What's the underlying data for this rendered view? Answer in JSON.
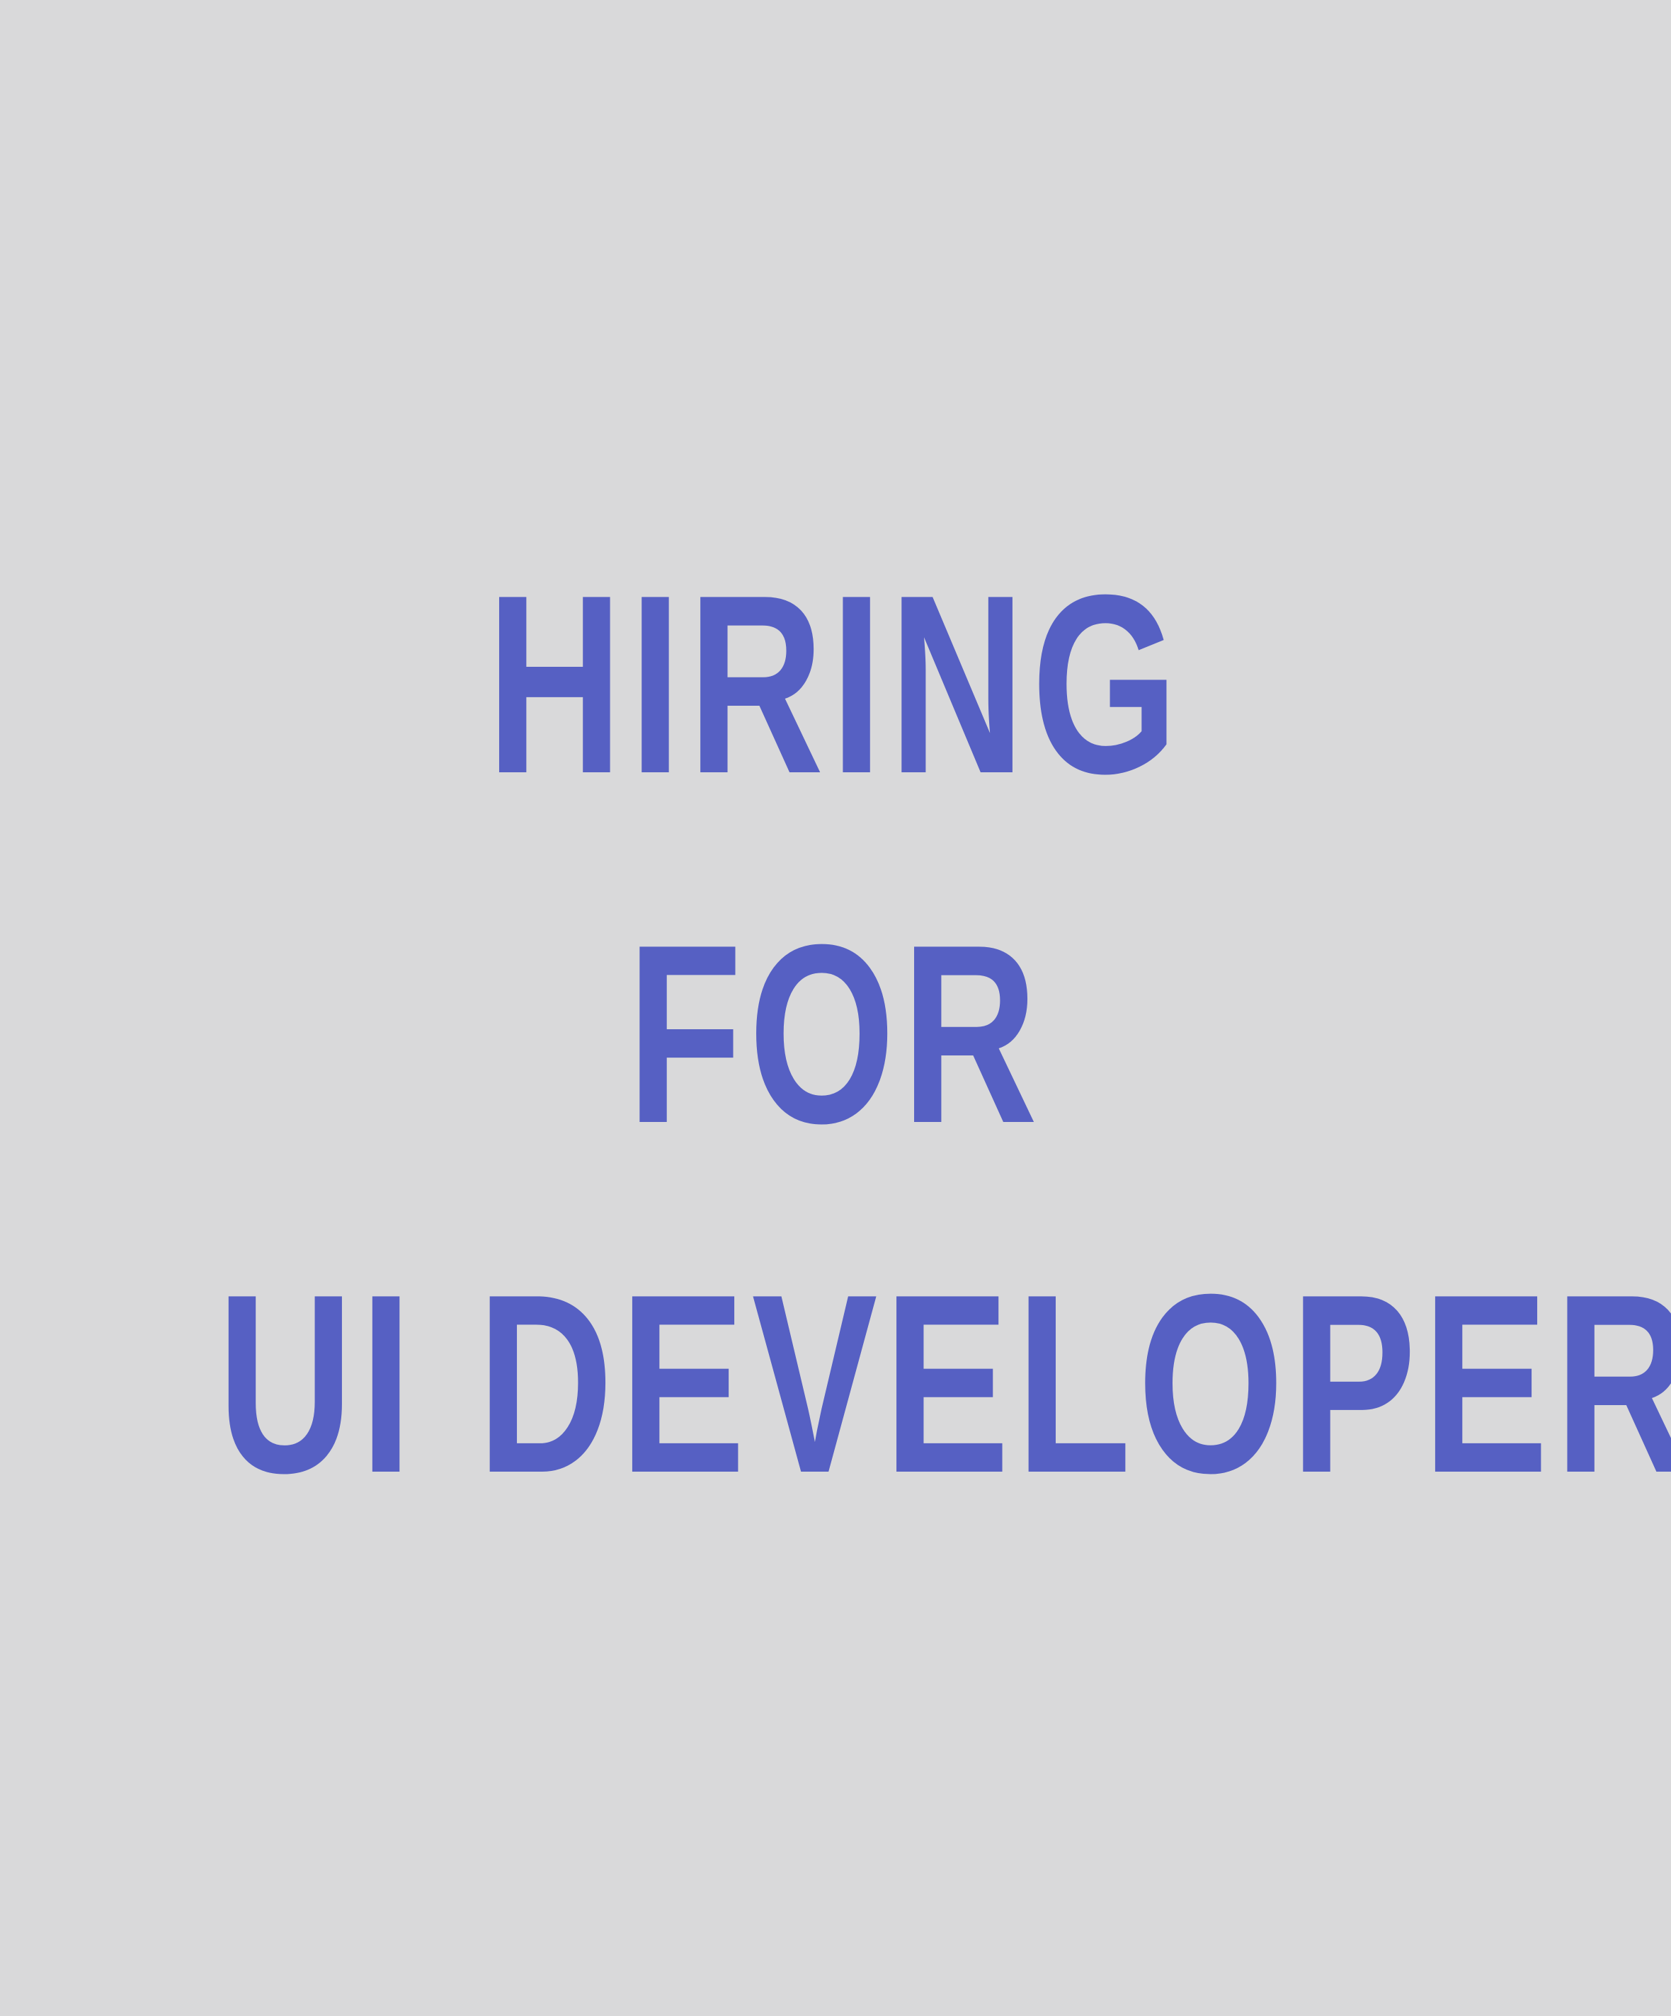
{
  "poster": {
    "headline_lines": [
      "HIRING",
      "FOR",
      "UI DEVELOPER"
    ],
    "text_color": "#5660c3",
    "background_color": "#d9d9da"
  }
}
